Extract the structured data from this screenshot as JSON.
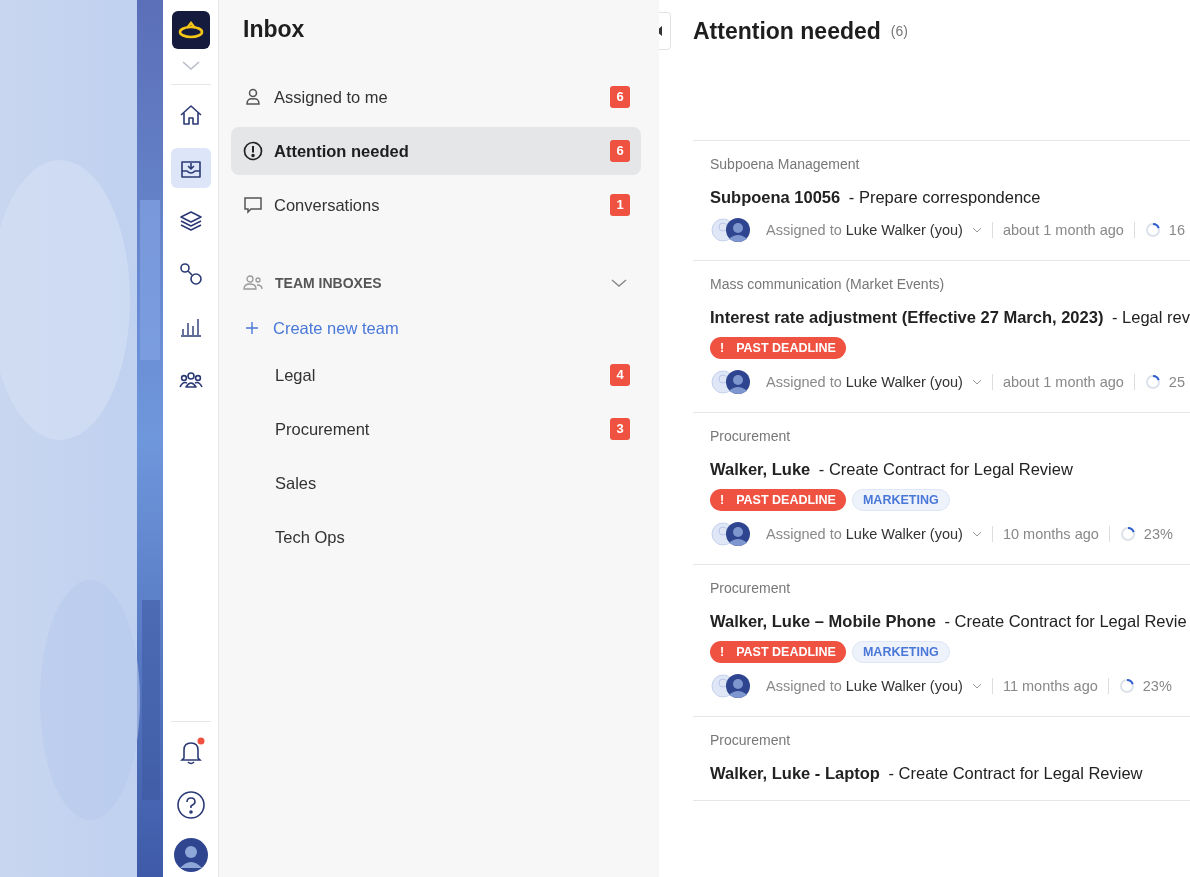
{
  "rail": {
    "top": [
      {
        "kind": "home",
        "selected": false
      },
      {
        "kind": "inbox",
        "selected": true
      },
      {
        "kind": "layers",
        "selected": false
      },
      {
        "kind": "workflow",
        "selected": false
      },
      {
        "kind": "chart",
        "selected": false
      },
      {
        "kind": "team",
        "selected": false
      }
    ],
    "notifications_unread": true
  },
  "sidebar": {
    "title": "Inbox",
    "items": [
      {
        "kind": "person",
        "label": "Assigned to me",
        "count": "6",
        "selected": false
      },
      {
        "kind": "alert",
        "label": "Attention needed",
        "count": "6",
        "selected": true
      },
      {
        "kind": "chat",
        "label": "Conversations",
        "count": "1",
        "selected": false
      }
    ],
    "team_section": {
      "title": "TEAM INBOXES",
      "expanded": true,
      "create": "Create new team",
      "teams": [
        {
          "label": "Legal",
          "count": "4"
        },
        {
          "label": "Procurement",
          "count": "3"
        },
        {
          "label": "Sales"
        },
        {
          "label": "Tech Ops"
        }
      ]
    }
  },
  "main": {
    "title": "Attention needed",
    "count": "(6)",
    "tasks": [
      {
        "category": "Subpoena Management",
        "title": "**Subpoena 10056** - Prepare correspondence",
        "assigned_label": "Assigned to",
        "assignee": "Luke Walker (you)",
        "time": "about 1 month ago",
        "progress": "16"
      },
      {
        "category": "Mass communication (Market Events)",
        "title": "**Interest rate adjustment (Effective 27 March, 2023)** - Legal rev",
        "tags": [
          {
            "kind": "deadline",
            "mark": "!",
            "label": "PAST DEADLINE"
          }
        ],
        "assigned_label": "Assigned to",
        "assignee": "Luke Walker (you)",
        "time": "about 1 month ago",
        "progress": "25"
      },
      {
        "category": "Procurement",
        "title": "**Walker, Luke** - Create Contract for Legal Review",
        "tags": [
          {
            "kind": "deadline",
            "mark": "!",
            "label": "PAST DEADLINE"
          },
          {
            "kind": "team",
            "label": "MARKETING"
          }
        ],
        "assigned_label": "Assigned to",
        "assignee": "Luke Walker (you)",
        "time": "10 months ago",
        "progress": "23%"
      },
      {
        "category": "Procurement",
        "title": "**Walker, Luke – Mobile Phone** - Create Contract for Legal Revie",
        "tags": [
          {
            "kind": "deadline",
            "mark": "!",
            "label": "PAST DEADLINE"
          },
          {
            "kind": "team",
            "label": "MARKETING"
          }
        ],
        "assigned_label": "Assigned to",
        "assignee": "Luke Walker (you)",
        "time": "11 months ago",
        "progress": "23%"
      },
      {
        "category": "Procurement",
        "title": "**Walker, Luke - Laptop** - Create Contract for Legal Review"
      }
    ]
  }
}
